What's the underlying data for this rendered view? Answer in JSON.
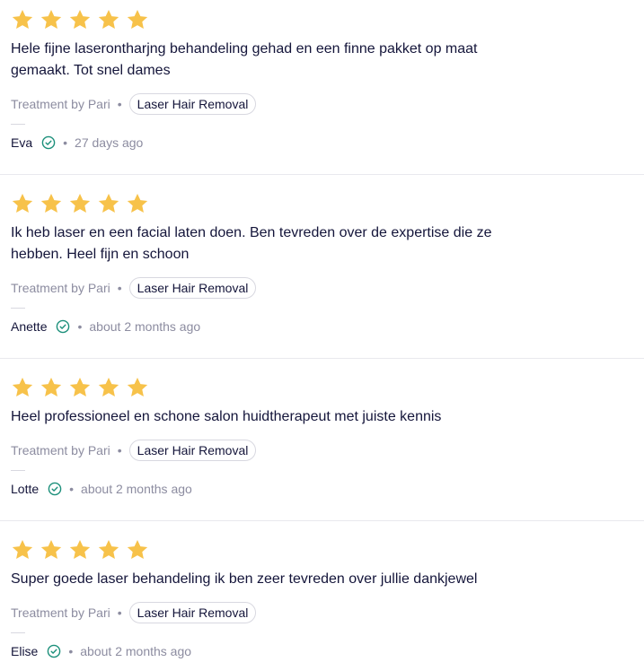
{
  "colors": {
    "star": "#f7c24a",
    "verified": "#1b8f7a",
    "text": "#14153a",
    "muted": "#8c8ca0"
  },
  "reviews": [
    {
      "rating": 5,
      "text": "Hele fijne laserontharjng behandeling gehad en een finne pakket op maat gemaakt. Tot snel dames",
      "treatment_by": "Treatment by Pari",
      "treatment": "Laser Hair Removal",
      "author": "Eva",
      "time": "27 days ago"
    },
    {
      "rating": 5,
      "text": "Ik heb laser en een facial laten doen. Ben tevreden over de expertise die ze hebben. Heel fijn en schoon",
      "treatment_by": "Treatment by Pari",
      "treatment": "Laser Hair Removal",
      "author": "Anette",
      "time": "about 2 months ago"
    },
    {
      "rating": 5,
      "text": "Heel professioneel en schone salon huidtherapeut met juiste kennis",
      "treatment_by": "Treatment by Pari",
      "treatment": "Laser Hair Removal",
      "author": "Lotte",
      "time": "about 2 months ago"
    },
    {
      "rating": 5,
      "text": "Super goede laser behandeling ik ben zeer tevreden over jullie dankjewel",
      "treatment_by": "Treatment by Pari",
      "treatment": "Laser Hair Removal",
      "author": "Elise",
      "time": "about 2 months ago"
    }
  ]
}
